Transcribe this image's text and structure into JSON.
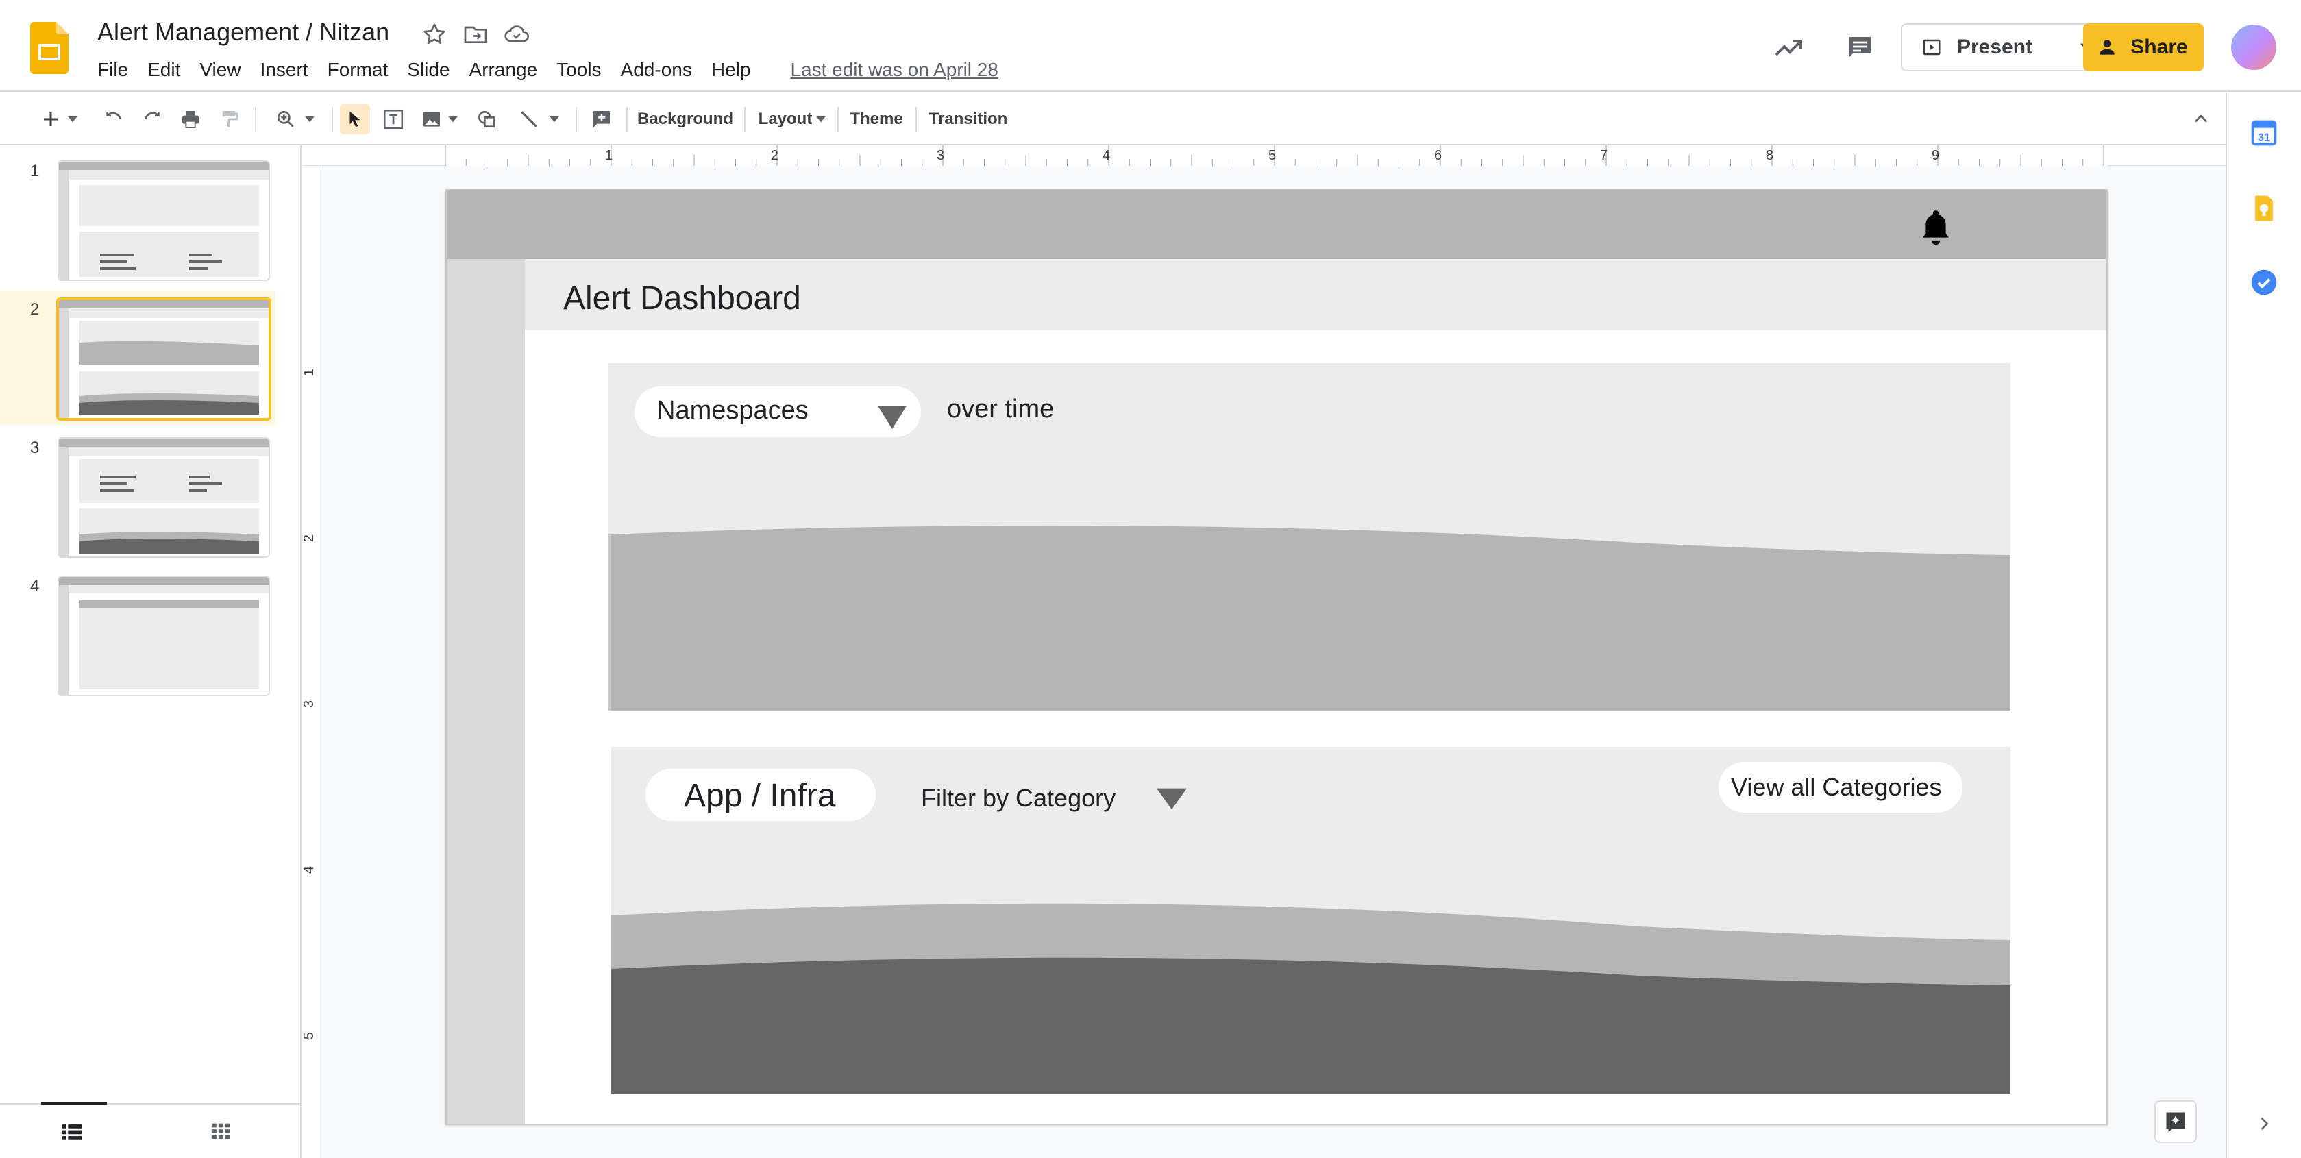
{
  "app": {
    "doc_title": "Alert Management / Nitzan",
    "menu": [
      "File",
      "Edit",
      "View",
      "Insert",
      "Format",
      "Slide",
      "Arrange",
      "Tools",
      "Add-ons",
      "Help"
    ],
    "last_edit": "Last edit was on April 28",
    "present_label": "Present",
    "share_label": "Share"
  },
  "toolbar": {
    "background_label": "Background",
    "layout_label": "Layout",
    "theme_label": "Theme",
    "transition_label": "Transition"
  },
  "ruler": {
    "h_numbers": [
      "1",
      "2",
      "3",
      "4",
      "5",
      "6",
      "7",
      "8",
      "9"
    ],
    "v_numbers": [
      "1",
      "2",
      "3",
      "4",
      "5"
    ]
  },
  "filmstrip": {
    "slides": [
      {
        "number": "1",
        "selected": false
      },
      {
        "number": "2",
        "selected": true
      },
      {
        "number": "3",
        "selected": false
      },
      {
        "number": "4",
        "selected": false
      }
    ]
  },
  "slide": {
    "title": "Alert Dashboard",
    "panel1": {
      "dropdown_label": "Namespaces",
      "suffix": "over time"
    },
    "panel2": {
      "pill_label": "App / Infra",
      "filter_label": "Filter by Category",
      "view_all_label": "View all Categories"
    }
  },
  "colors": {
    "accent": "#f6bf26",
    "selected_slide_bg": "#fef7e0",
    "chart_light": "#b5b5b5",
    "chart_dark": "#666666",
    "panel_bg": "#ececec"
  },
  "icons": {
    "side_panel": [
      "calendar-icon",
      "keep-icon",
      "tasks-icon"
    ]
  }
}
